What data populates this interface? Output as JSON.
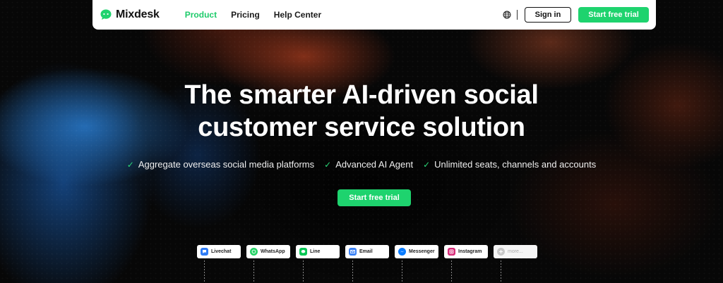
{
  "brand": {
    "name": "Mixdesk",
    "accent": "#1ed36e"
  },
  "nav": {
    "links": [
      {
        "label": "Product",
        "active": true
      },
      {
        "label": "Pricing",
        "active": false
      },
      {
        "label": "Help Center",
        "active": false
      }
    ],
    "language_icon": "globe-icon",
    "signin_label": "Sign in",
    "cta_label": "Start free trial"
  },
  "hero": {
    "title_line1": "The smarter AI-driven social",
    "title_line2": "customer service solution",
    "features": [
      "Aggregate overseas social media platforms",
      "Advanced AI Agent",
      "Unlimited seats, channels and accounts"
    ],
    "check_icon": "check-icon",
    "cta_label": "Start free trial"
  },
  "channels": [
    {
      "label": "Livechat",
      "icon": "livechat-icon",
      "color": "#2f7cf6"
    },
    {
      "label": "WhatsApp",
      "icon": "whatsapp-icon",
      "color": "#25d366"
    },
    {
      "label": "Line",
      "icon": "line-icon",
      "color": "#06c755"
    },
    {
      "label": "Email",
      "icon": "email-icon",
      "color": "#3b82f6"
    },
    {
      "label": "Messenger",
      "icon": "messenger-icon",
      "color": "#0a7cff"
    },
    {
      "label": "Instagram",
      "icon": "instagram-icon",
      "color": "#d62976"
    },
    {
      "label": "more...",
      "icon": "plus-icon",
      "color": "#c8c8c8"
    }
  ]
}
